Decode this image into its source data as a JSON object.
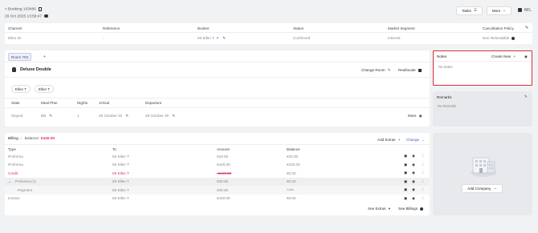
{
  "header": {
    "back_label": "< Booking 103486",
    "datetime": "29 Oct 2025 13:58:47",
    "tasks_label": "Tasks",
    "more_label": "More",
    "language": "BEL"
  },
  "booking_info": {
    "headers": [
      "Channel",
      "Reference",
      "Booker",
      "Status",
      "Market Segment",
      "Cancellation Policy"
    ],
    "values": [
      "Ellen W.",
      "-",
      "Mr Ellen T",
      "Confirmed",
      "Internet",
      "Non Refundable"
    ]
  },
  "room_tabs": {
    "active": "Room 703",
    "add": "+"
  },
  "room": {
    "type": "Deluxe Double",
    "change_room": "Change Room",
    "reallocate": "Reallocate",
    "guests": [
      "Ellen T",
      "Ellen T"
    ],
    "stay_headers": [
      "State",
      "Meal Plan",
      "Nights",
      "Arrival",
      "Departure"
    ],
    "stay_values": [
      "Stayed",
      "BB",
      "1",
      "28 October 25",
      "29 October 25"
    ],
    "more_label": "More"
  },
  "billing": {
    "title": "Billing",
    "balance_label": "Balance:",
    "balance_value": "€440.00",
    "add_extras": "Add Extras",
    "change": "Change",
    "headers": [
      "Type",
      "To",
      "Amount",
      "Balance"
    ],
    "rows": [
      {
        "type": "Proforma",
        "to": "Mr Ellen T",
        "amount": "€20.00",
        "balance": "€20.00"
      },
      {
        "type": "Proforma",
        "to": "Mr Ellen T",
        "amount": "€420.00",
        "balance": "€420.00"
      },
      {
        "type": "Credit",
        "to": "Mr Ellen T",
        "amount": "-€440.00",
        "balance": "€0.00"
      },
      {
        "type": "Proforma (1)",
        "to": "Mr Ellen T",
        "amount": "€30.00",
        "balance": "€0.00"
      },
      {
        "type": "Payment",
        "to": "Mr Ellen T",
        "amount": "€30.00",
        "balance": "Cash"
      },
      {
        "type": "Invoice",
        "to": "Mr Ellen T",
        "amount": "€440.00",
        "balance": "€0.00"
      }
    ],
    "see_extras": "See Extras",
    "see_billings": "See Billings"
  },
  "notes": {
    "title": "Notes",
    "create_new": "Create New",
    "empty": "No Notes"
  },
  "remarks": {
    "title": "Remarks",
    "empty": "No Remarks"
  },
  "company": {
    "add_label": "Add Company"
  },
  "colors": {
    "accent_red": "#e0315c",
    "highlight_border": "#d62e3a"
  }
}
